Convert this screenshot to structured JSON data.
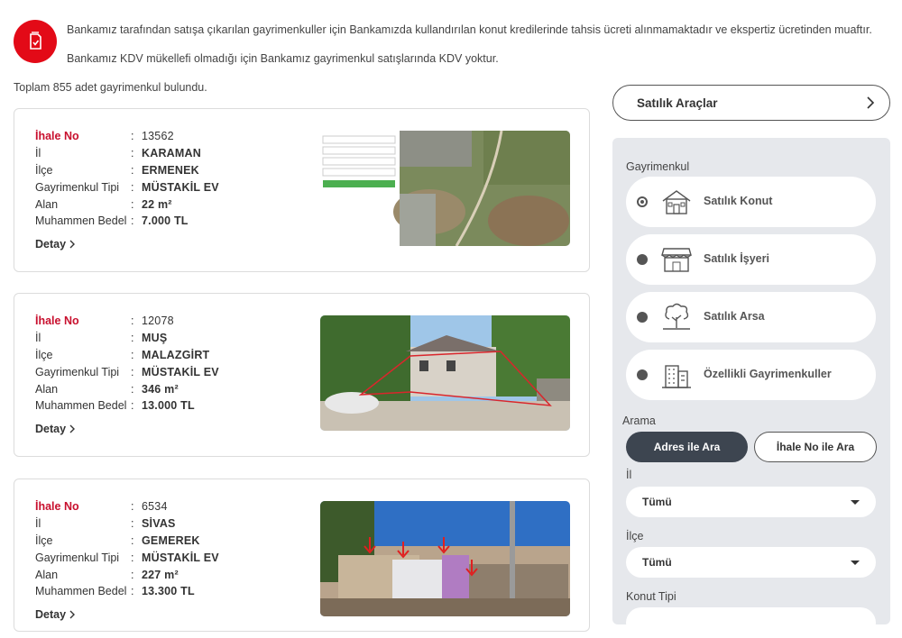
{
  "notice": {
    "line1": "Bankamız tarafından satışa çıkarılan gayrimenkuller için Bankamızda kullandırılan konut kredilerinde tahsis ücreti alınmamaktadır ve ekspertiz ücretinden muaftır.",
    "line2": "Bankamız KDV mükellefi olmadığı için Bankamız gayrimenkul satışlarında KDV yoktur."
  },
  "result_count": "Toplam 855 adet gayrimenkul bulundu.",
  "labels": {
    "ihale_no": "İhale No",
    "il": "İl",
    "ilce": "İlçe",
    "tip": "Gayrimenkul Tipi",
    "alan": "Alan",
    "bedel": "Muhammen Bedel",
    "sep": ":",
    "detail": "Detay"
  },
  "listings": [
    {
      "ihale_no": "13562",
      "il": "KARAMAN",
      "ilce": "ERMENEK",
      "tip": "MÜSTAKİL EV",
      "alan": "22 m²",
      "bedel": "7.000 TL"
    },
    {
      "ihale_no": "12078",
      "il": "MUŞ",
      "ilce": "MALAZGİRT",
      "tip": "MÜSTAKİL EV",
      "alan": "346 m²",
      "bedel": "13.000 TL"
    },
    {
      "ihale_no": "6534",
      "il": "SİVAS",
      "ilce": "GEMEREK",
      "tip": "MÜSTAKİL EV",
      "alan": "227 m²",
      "bedel": "13.300 TL"
    }
  ],
  "sidebar": {
    "vehicles_button": "Satılık Araçlar",
    "property_label": "Gayrimenkul",
    "property_types": [
      {
        "label": "Satılık Konut",
        "icon": "house-icon",
        "selected": true
      },
      {
        "label": "Satılık İşyeri",
        "icon": "storefront-icon",
        "selected": false
      },
      {
        "label": "Satılık Arsa",
        "icon": "tree-icon",
        "selected": false
      },
      {
        "label": "Özellikli Gayrimenkuller",
        "icon": "building-icon",
        "selected": false
      }
    ],
    "search_label": "Arama",
    "search_by_address": "Adres ile Ara",
    "search_by_tender": "İhale No ile Ara",
    "il_label": "İl",
    "il_value": "Tümü",
    "ilce_label": "İlçe",
    "ilce_value": "Tümü",
    "konut_tipi_label": "Konut Tipi"
  },
  "colors": {
    "brand_red": "#e30a17",
    "label_red": "#c8102e",
    "dark_button": "#3d4550",
    "panel_bg": "#e6e8ec"
  }
}
